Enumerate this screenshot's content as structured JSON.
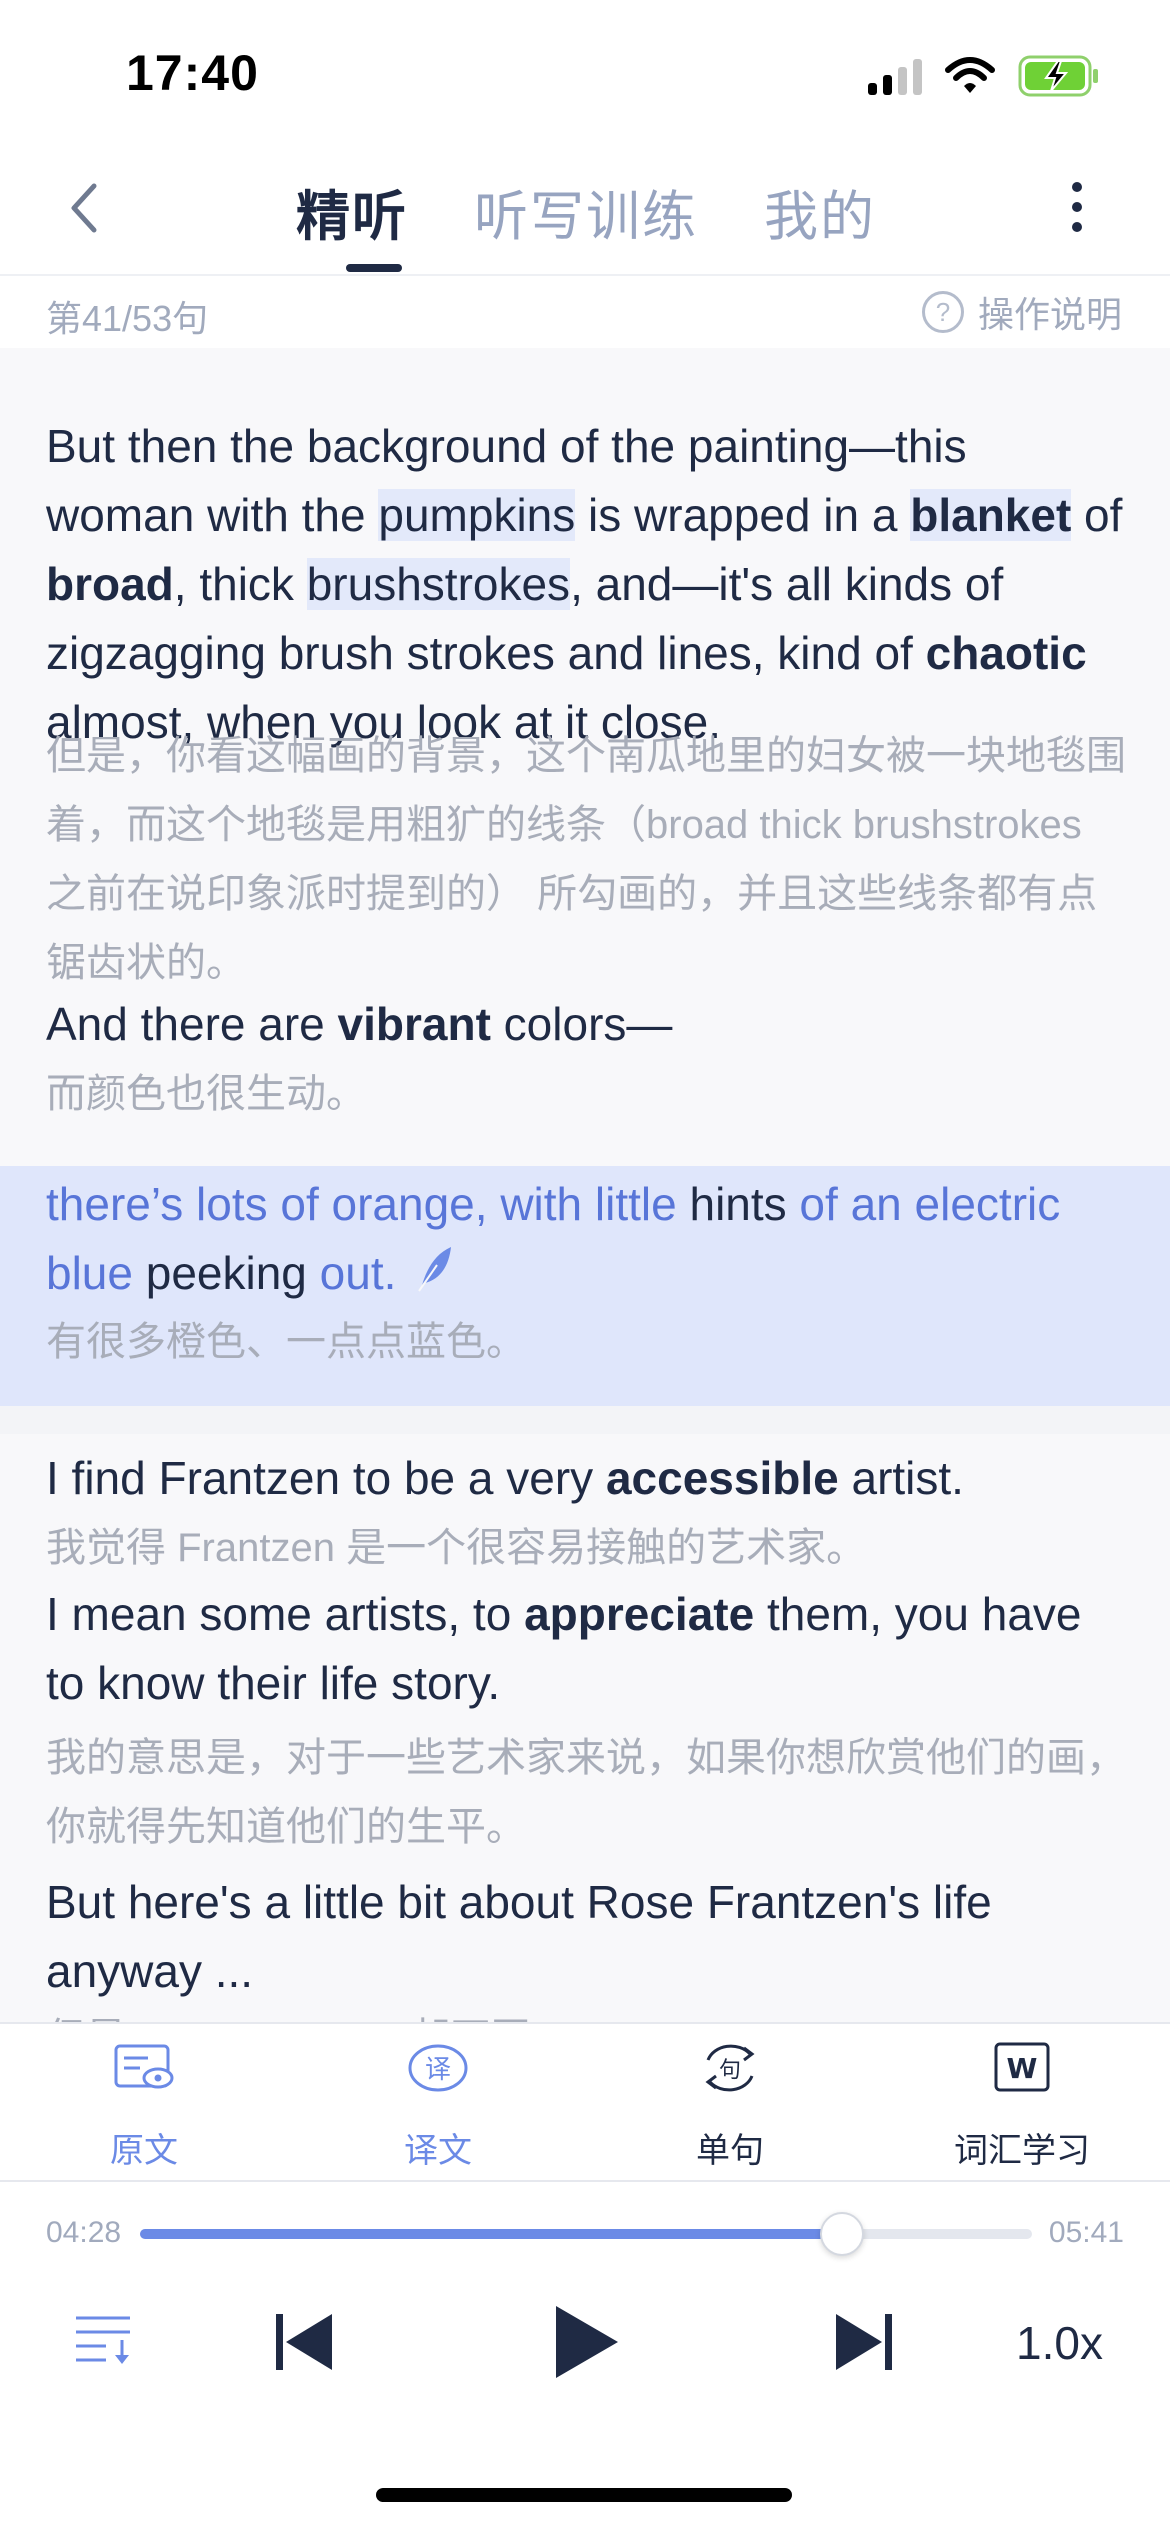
{
  "status": {
    "time": "17:40"
  },
  "nav": {
    "tabs": [
      {
        "label": "精听"
      },
      {
        "label": "听写训练"
      },
      {
        "label": "我的"
      }
    ]
  },
  "subbar": {
    "counter": "第41/53句",
    "help": "操作说明"
  },
  "content": {
    "seg1_en": "But then the background of the painting—this woman with the pumpkins is wrapped in a blanket of broad, thick brushstrokes, and—it's all kinds of zigzagging brush strokes and lines, kind of chaotic almost, when you look at it close.",
    "seg1_en_parts": {
      "a": "But then the background of the painting—this woman with the ",
      "pumpkins": "pumpkins",
      "b": " is wrapped in a ",
      "blanket": "blanket",
      "c": " of ",
      "broad": "broad",
      "d": ", thick ",
      "brushstrokes": "brushstrokes",
      "e": ", and—it's all kinds of zigzagging brush strokes and lines, kind of ",
      "chaotic": "chaotic",
      "f": " almost, when you look at it close."
    },
    "seg1_zh": "但是，你看这幅画的背景，这个南瓜地里的妇女被一块地毯围着，而这个地毯是用粗犷的线条（broad thick brushstrokes 之前在说印象派时提到的） 所勾画的，并且这些线条都有点锯齿状的。",
    "seg2_en_parts": {
      "a": "And there are ",
      "vibrant": "vibrant",
      "b": " colors—"
    },
    "seg2_zh": "而颜色也很生动。",
    "seg3_en_parts": {
      "a": "there’s lots of orange, with little ",
      "hints": "hints",
      "b": " of an electric blue ",
      "peeking": "peeking",
      "c": " out."
    },
    "seg3_zh": "有很多橙色、一点点蓝色。",
    "seg4_en_parts": {
      "a": "I find Frantzen to be a very ",
      "accessible": "accessible",
      "b": " artist."
    },
    "seg4_zh": "我觉得 Frantzen 是一个很容易接触的艺术家。",
    "seg5_en_parts": {
      "a": "I mean some artists, to ",
      "appreciate": "appreciate",
      "b": " them, you have to know their life story."
    },
    "seg5_zh": "我的意思是，对于一些艺术家来说，如果你想欣赏他们的画，你就得先知道他们的生平。",
    "seg6_en": "But here's a little bit about Rose Frantzen's life anyway ...",
    "seg6_zh": "但是 Rose Frantzen 却不同:"
  },
  "toolbar": {
    "items": [
      {
        "label": "原文",
        "icon": "original-text-icon",
        "color": "#6b8ae6"
      },
      {
        "label": "译文",
        "icon": "translation-icon",
        "color": "#6b8ae6"
      },
      {
        "label": "单句",
        "icon": "single-sentence-icon",
        "color": "#1f2a44"
      },
      {
        "label": "词汇学习",
        "icon": "vocabulary-icon",
        "color": "#1f2a44"
      }
    ]
  },
  "player": {
    "current": "04:28",
    "total": "05:41",
    "progress": 0.787,
    "speed": "1.0x"
  },
  "colors": {
    "accent": "#6b8ae6",
    "text": "#1f2a44",
    "active_band": "#dfe6fb"
  }
}
